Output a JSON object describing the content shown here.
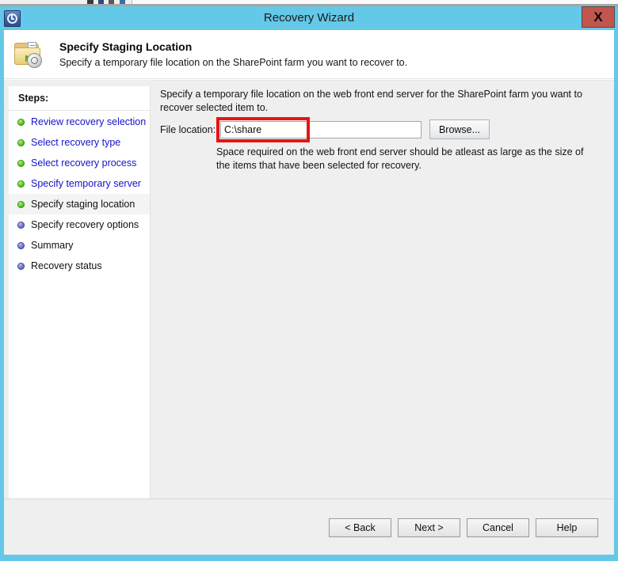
{
  "window": {
    "title": "Recovery Wizard",
    "app_icon": "recovery-clock-icon",
    "close_label": "X",
    "titlebar_color": "#64c8e8",
    "close_color": "#c1564f"
  },
  "header": {
    "icon": "folder-recovery-icon",
    "title": "Specify Staging Location",
    "subtitle": "Specify a temporary file location on the SharePoint farm you want to recover to."
  },
  "sidebar": {
    "heading": "Steps:",
    "items": [
      {
        "label": "Review recovery selection",
        "state": "done"
      },
      {
        "label": "Select recovery type",
        "state": "done"
      },
      {
        "label": "Select recovery process",
        "state": "done"
      },
      {
        "label": "Specify temporary server",
        "state": "done"
      },
      {
        "label": "Specify staging location",
        "state": "current"
      },
      {
        "label": "Specify recovery options",
        "state": "todo"
      },
      {
        "label": "Summary",
        "state": "todo"
      },
      {
        "label": "Recovery status",
        "state": "todo"
      }
    ]
  },
  "main": {
    "intro": "Specify a temporary file location on the web front end server for the SharePoint farm you want to recover selected item to.",
    "file_label": "File location:",
    "file_value": "C:\\share",
    "file_placeholder": "",
    "browse_label": "Browse...",
    "hint": "Space required on the web front end server should be atleast as large as the size of the items that have been selected for recovery.",
    "annotation_color": "#e81414"
  },
  "footer": {
    "back_label": "< Back",
    "next_label": "Next >",
    "cancel_label": "Cancel",
    "help_label": "Help"
  }
}
